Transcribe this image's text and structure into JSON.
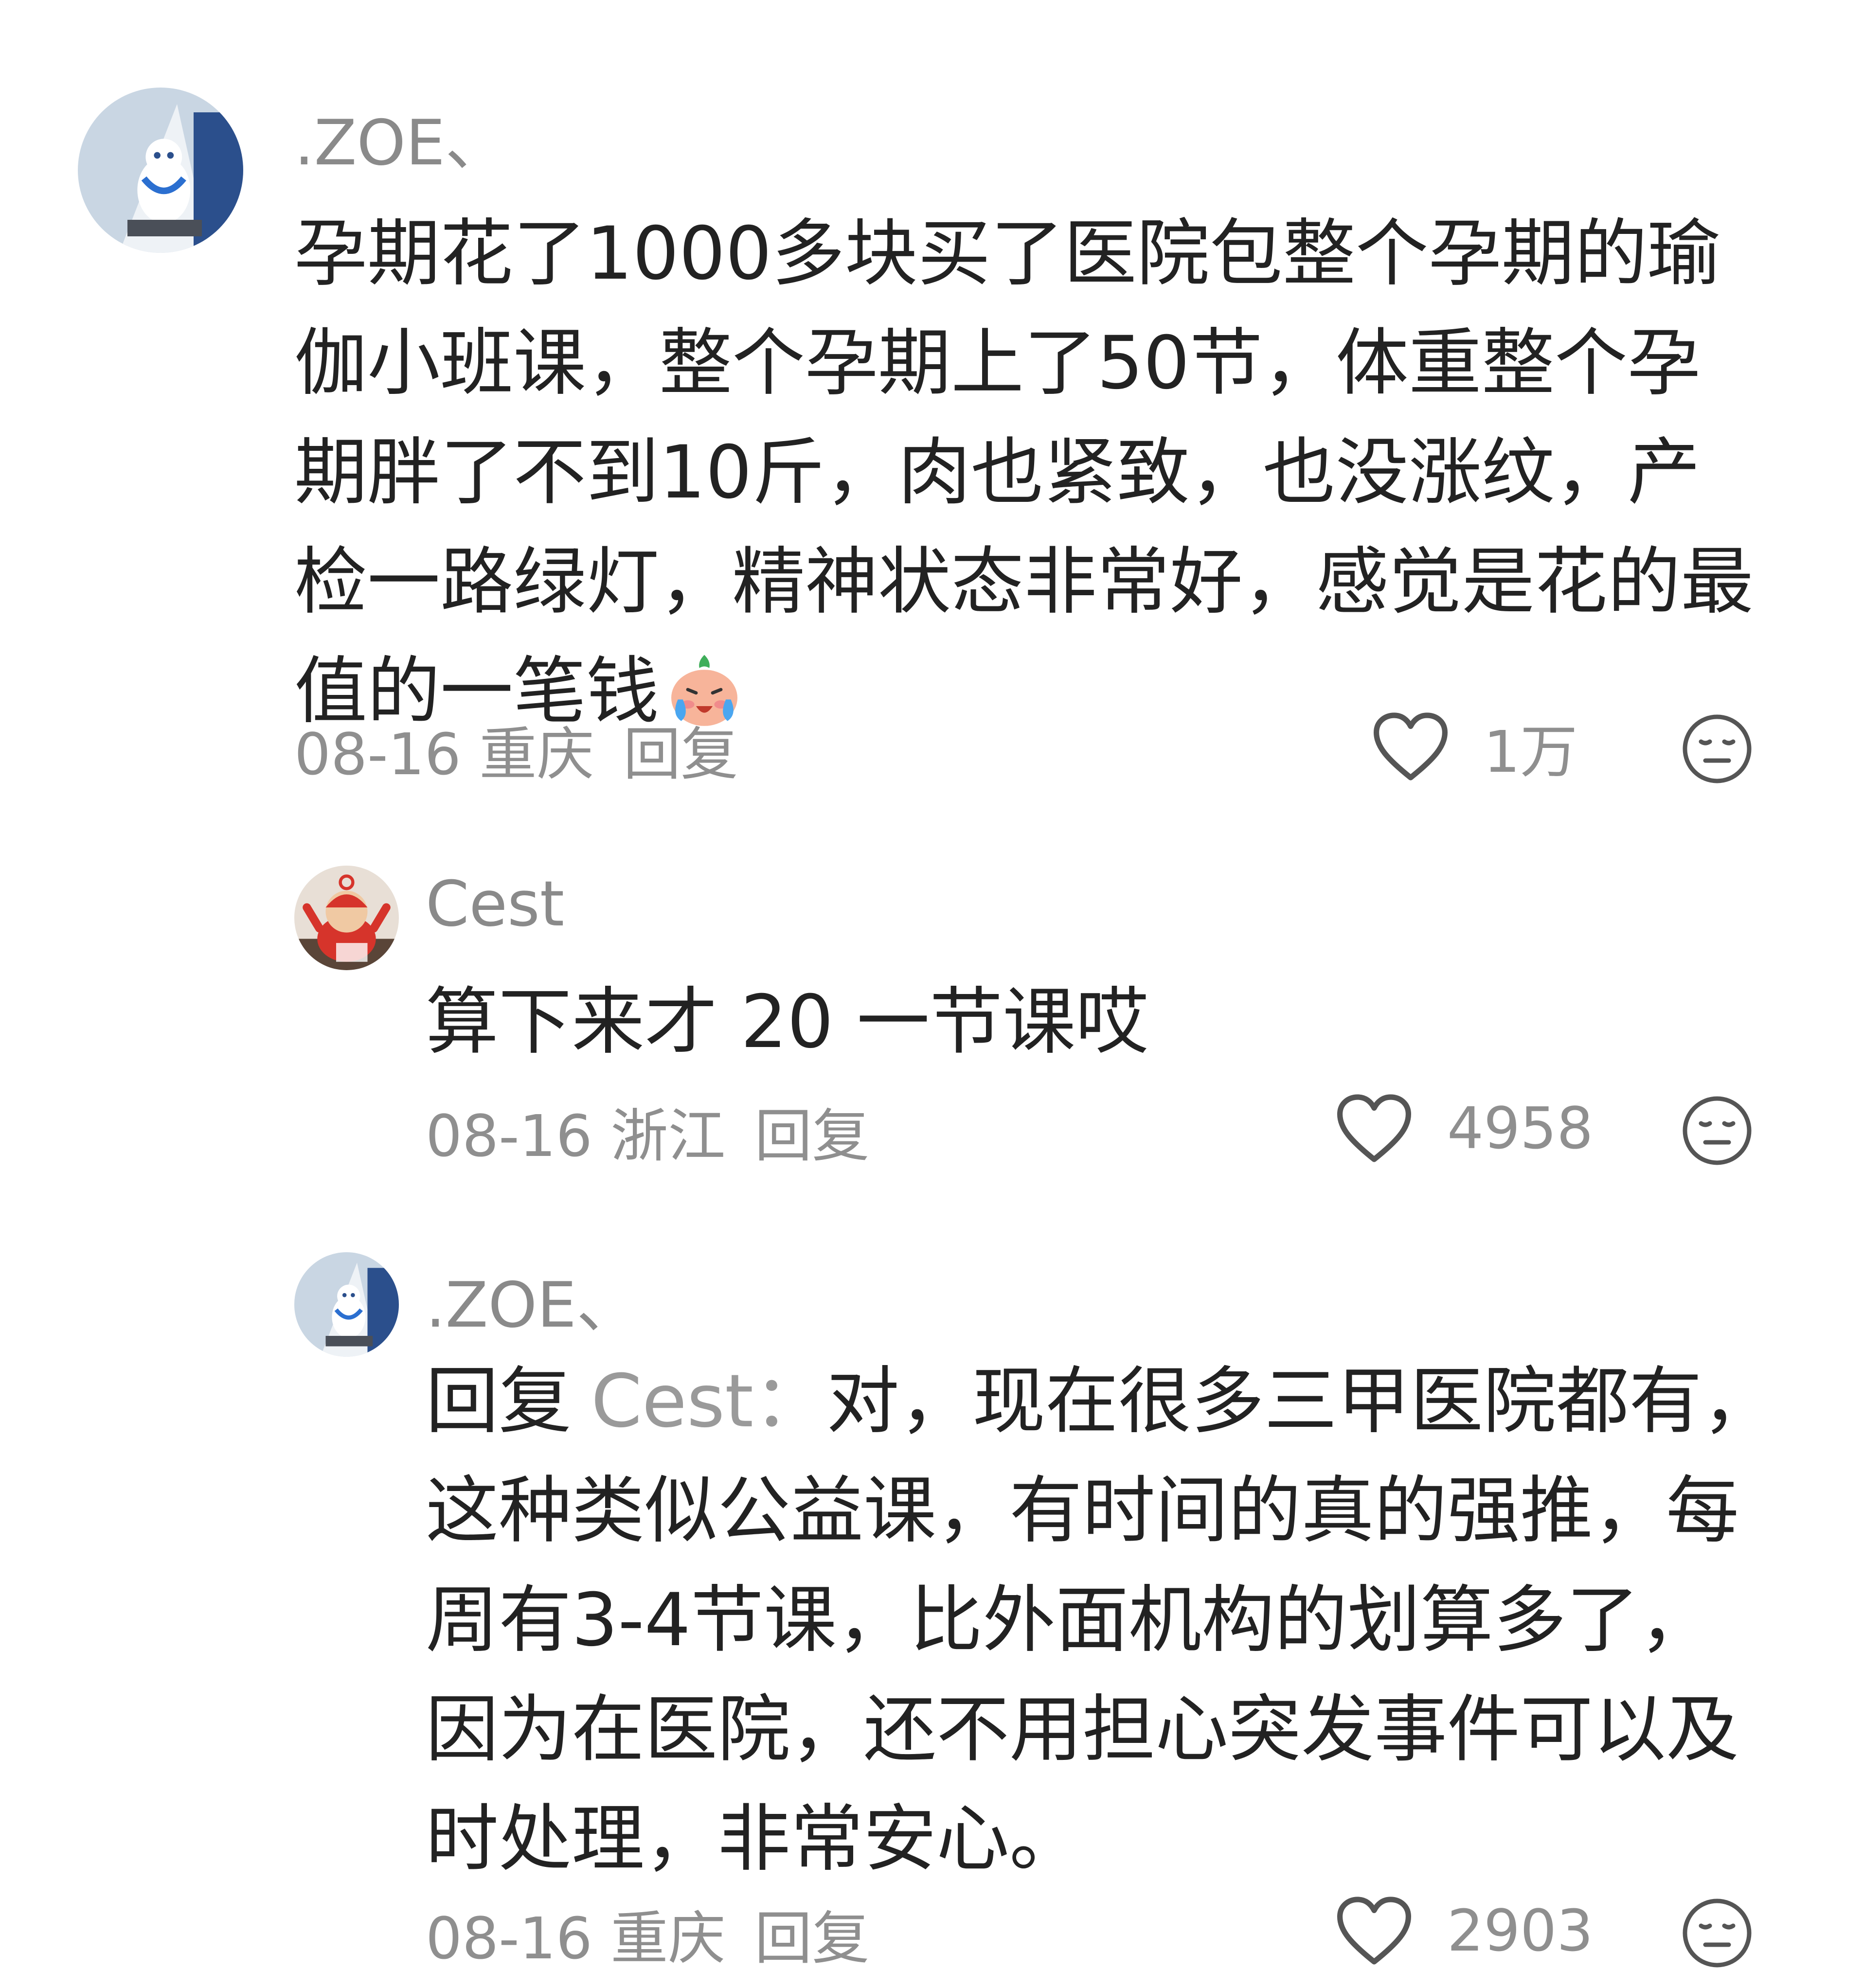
{
  "comments": [
    {
      "username": ".ZOE、",
      "text": "孕期花了1000多块买了医院包整个孕期的瑜伽小班课，整个孕期上了50节，体重整个孕期胖了不到10斤，肉也紧致，也没涨纹，产检一路绿灯，精神状态非常好，感觉是花的最值的一笔钱",
      "emoji": "crying-face-emoji",
      "date_location": "08-16 重庆",
      "reply_label": "回复",
      "likes": "1万"
    },
    {
      "username": "Cest",
      "text": "算下来才 20 一节课哎",
      "date_location": "08-16 浙江",
      "reply_label": "回复",
      "likes": "4958"
    },
    {
      "username": ".ZOE、",
      "reply_prefix": "回复",
      "reply_target": "Cest：",
      "text": "对，现在很多三甲医院都有，这种类似公益课，有时间的真的强推，每周有3-4节课，比外面机构的划算多了，因为在医院，还不用担心突发事件可以及时处理，非常安心。",
      "date_location": "08-16 重庆",
      "reply_label": "回复",
      "likes": "2903"
    }
  ],
  "colors": {
    "text": "#222222",
    "muted": "#8f8f8f",
    "icon": "#555555"
  }
}
